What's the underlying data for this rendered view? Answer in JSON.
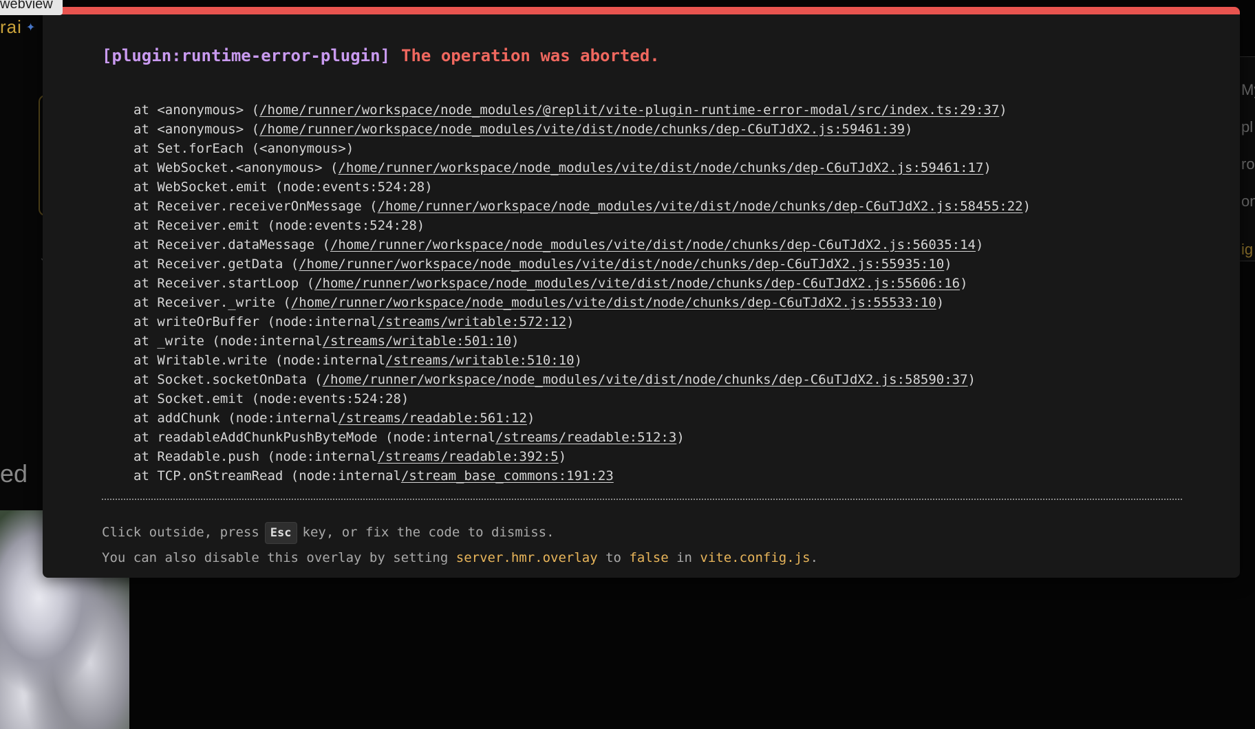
{
  "background_page": {
    "webview_label": "webview",
    "brand_text": "rai",
    "partial_heading": "ed",
    "right_panel_items": [
      "My",
      "pl",
      "ro",
      "on",
      "ig"
    ]
  },
  "overlay": {
    "accent_color": "#e8544f",
    "plugin": "[plugin:runtime-error-plugin]",
    "message": "The operation was aborted.",
    "stack": [
      {
        "prefix": "at <anonymous> (",
        "file": "/home/runner/workspace/node_modules/@replit/vite-plugin-runtime-error-modal/src/index.ts:29:37",
        "suffix": ")"
      },
      {
        "prefix": "at <anonymous> (",
        "file": "/home/runner/workspace/node_modules/vite/dist/node/chunks/dep-C6uTJdX2.js:59461:39",
        "suffix": ")"
      },
      {
        "prefix": "at Set.forEach (<anonymous>)",
        "file": "",
        "suffix": ""
      },
      {
        "prefix": "at WebSocket.<anonymous> (",
        "file": "/home/runner/workspace/node_modules/vite/dist/node/chunks/dep-C6uTJdX2.js:59461:17",
        "suffix": ")"
      },
      {
        "prefix": "at WebSocket.emit (node:events:524:28)",
        "file": "",
        "suffix": ""
      },
      {
        "prefix": "at Receiver.receiverOnMessage (",
        "file": "/home/runner/workspace/node_modules/vite/dist/node/chunks/dep-C6uTJdX2.js:58455:22",
        "suffix": ")"
      },
      {
        "prefix": "at Receiver.emit (node:events:524:28)",
        "file": "",
        "suffix": ""
      },
      {
        "prefix": "at Receiver.dataMessage (",
        "file": "/home/runner/workspace/node_modules/vite/dist/node/chunks/dep-C6uTJdX2.js:56035:14",
        "suffix": ")"
      },
      {
        "prefix": "at Receiver.getData (",
        "file": "/home/runner/workspace/node_modules/vite/dist/node/chunks/dep-C6uTJdX2.js:55935:10",
        "suffix": ")"
      },
      {
        "prefix": "at Receiver.startLoop (",
        "file": "/home/runner/workspace/node_modules/vite/dist/node/chunks/dep-C6uTJdX2.js:55606:16",
        "suffix": ")"
      },
      {
        "prefix": "at Receiver._write (",
        "file": "/home/runner/workspace/node_modules/vite/dist/node/chunks/dep-C6uTJdX2.js:55533:10",
        "suffix": ")"
      },
      {
        "prefix": "at writeOrBuffer (node:internal",
        "file": "/streams/writable:572:12",
        "suffix": ")"
      },
      {
        "prefix": "at _write (node:internal",
        "file": "/streams/writable:501:10",
        "suffix": ")"
      },
      {
        "prefix": "at Writable.write (node:internal",
        "file": "/streams/writable:510:10",
        "suffix": ")"
      },
      {
        "prefix": "at Socket.socketOnData (",
        "file": "/home/runner/workspace/node_modules/vite/dist/node/chunks/dep-C6uTJdX2.js:58590:37",
        "suffix": ")"
      },
      {
        "prefix": "at Socket.emit (node:events:524:28)",
        "file": "",
        "suffix": ""
      },
      {
        "prefix": "at addChunk (node:internal",
        "file": "/streams/readable:561:12",
        "suffix": ")"
      },
      {
        "prefix": "at readableAddChunkPushByteMode (node:internal",
        "file": "/streams/readable:512:3",
        "suffix": ")"
      },
      {
        "prefix": "at Readable.push (node:internal",
        "file": "/streams/readable:392:5",
        "suffix": ")"
      },
      {
        "prefix": "at TCP.onStreamRead (node:internal",
        "file": "/stream_base_commons:191:23",
        "suffix": ""
      }
    ],
    "tip": {
      "line1_before": "Click outside, press",
      "key": "Esc",
      "line1_after": "key, or fix the code to dismiss.",
      "line2_a": "You can also disable this overlay by setting ",
      "line2_code1": "server.hmr.overlay",
      "line2_b": " to ",
      "line2_code2": "false",
      "line2_c": " in ",
      "line2_code3": "vite.config.js",
      "line2_d": "."
    }
  }
}
